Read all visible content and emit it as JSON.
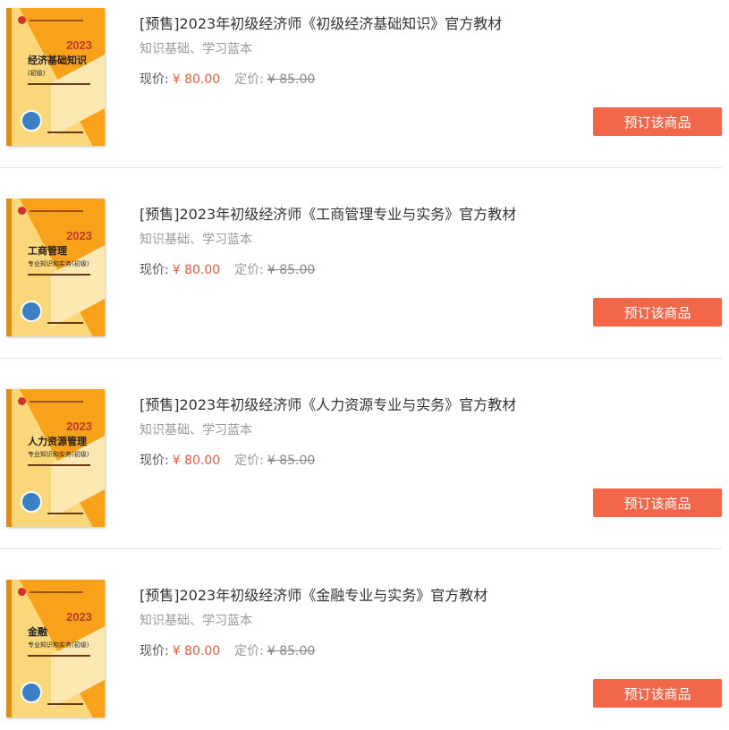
{
  "products": [
    {
      "title": "[预售]2023年初级经济师《初级经济基础知识》官方教材",
      "subtitle": "知识基础、学习蓝本",
      "current_label": "现价:",
      "current_price": "¥ 80.00",
      "original_label": "定价:",
      "original_price": "¥ 85.00",
      "button": "预订该商品",
      "cover": {
        "year": "2023",
        "title": "经济基础知识",
        "sub": "(初级)"
      }
    },
    {
      "title": "[预售]2023年初级经济师《工商管理专业与实务》官方教材",
      "subtitle": "知识基础、学习蓝本",
      "current_label": "现价:",
      "current_price": "¥ 80.00",
      "original_label": "定价:",
      "original_price": "¥ 85.00",
      "button": "预订该商品",
      "cover": {
        "year": "2023",
        "title": "工商管理",
        "sub": "专业知识和实务(初级)"
      }
    },
    {
      "title": "[预售]2023年初级经济师《人力资源专业与实务》官方教材",
      "subtitle": "知识基础、学习蓝本",
      "current_label": "现价:",
      "current_price": "¥ 80.00",
      "original_label": "定价:",
      "original_price": "¥ 85.00",
      "button": "预订该商品",
      "cover": {
        "year": "2023",
        "title": "人力资源管理",
        "sub": "专业知识和实务(初级)"
      }
    },
    {
      "title": "[预售]2023年初级经济师《金融专业与实务》官方教材",
      "subtitle": "知识基础、学习蓝本",
      "current_label": "现价:",
      "current_price": "¥ 80.00",
      "original_label": "定价:",
      "original_price": "¥ 85.00",
      "button": "预订该商品",
      "cover": {
        "year": "2023",
        "title": "金融",
        "sub": "专业知识和实务(初级)"
      }
    }
  ],
  "colors": {
    "accent": "#f2674a",
    "price": "#ee5a3a",
    "cover": "#f7a21a",
    "divider": "#e3e3e3"
  }
}
